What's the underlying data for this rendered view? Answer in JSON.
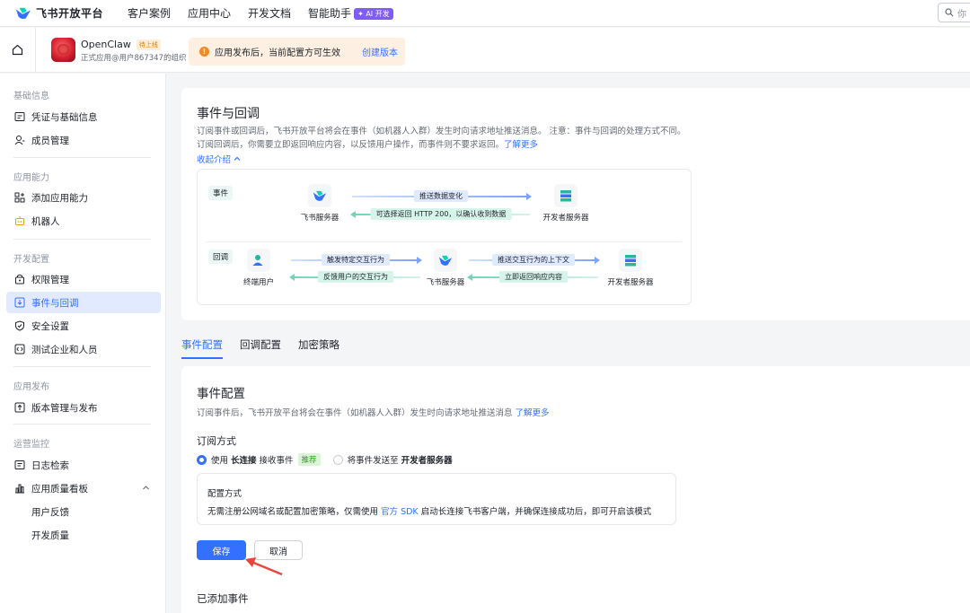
{
  "topnav": {
    "brand": "飞书开放平台",
    "links": [
      "客户案例",
      "应用中心",
      "开发文档",
      "智能助手"
    ],
    "ai_badge": "AI 开发",
    "search_placeholder": "你"
  },
  "app": {
    "name": "OpenClaw",
    "status": "待上线",
    "owner": "正式应用@用户867347的组织",
    "notice": "应用发布后，当前配置方可生效",
    "notice_link": "创建版本"
  },
  "sidebar": {
    "groups": [
      {
        "label": "基础信息",
        "items": [
          {
            "label": "凭证与基础信息",
            "icon": "credential-icon"
          },
          {
            "label": "成员管理",
            "icon": "member-icon"
          }
        ]
      },
      {
        "label": "应用能力",
        "items": [
          {
            "label": "添加应用能力",
            "icon": "add-capability-icon"
          },
          {
            "label": "机器人",
            "icon": "robot-icon"
          }
        ]
      },
      {
        "label": "开发配置",
        "items": [
          {
            "label": "权限管理",
            "icon": "permission-icon"
          },
          {
            "label": "事件与回调",
            "icon": "event-icon"
          },
          {
            "label": "安全设置",
            "icon": "shield-icon"
          },
          {
            "label": "测试企业和人员",
            "icon": "test-icon"
          }
        ]
      },
      {
        "label": "应用发布",
        "items": [
          {
            "label": "版本管理与发布",
            "icon": "publish-icon"
          }
        ]
      },
      {
        "label": "运营监控",
        "items": [
          {
            "label": "日志检索",
            "icon": "log-icon"
          },
          {
            "label": "应用质量看板",
            "icon": "chart-icon"
          },
          {
            "label": "用户反馈"
          },
          {
            "label": "开发质量"
          }
        ]
      }
    ]
  },
  "intro": {
    "title": "事件与回调",
    "desc": "订阅事件或回调后，飞书开放平台将会在事件（如机器人入群）发生时向请求地址推送消息。 注意：事件与回调的处理方式不同。订阅回调后，你需要立即返回响应内容，以反馈用户操作，而事件则不要求返回。",
    "learn_more": "了解更多",
    "collapse": "收起介绍",
    "diagram": {
      "tag_event": "事件",
      "tag_callback": "回调",
      "feishu_server": "飞书服务器",
      "dev_server": "开发者服务器",
      "end_user": "终端用户",
      "push_data": "推送数据变化",
      "return_200": "可选择返回 HTTP 200，以确认收到数据",
      "trigger": "触发特定交互行为",
      "feedback": "反馈用户的交互行为",
      "push_ctx": "推送交互行为的上下文",
      "return_resp": "立即返回响应内容"
    }
  },
  "tabs": [
    "事件配置",
    "回调配置",
    "加密策略"
  ],
  "event_config": {
    "title": "事件配置",
    "desc": "订阅事件后，飞书开放平台将会在事件（如机器人入群）发生时向请求地址推送消息",
    "learn_more": "了解更多",
    "sub_label": "订阅方式",
    "opt1_pre": "使用",
    "opt1_bold": "长连接",
    "opt1_post": "接收事件",
    "opt1_tag": "推荐",
    "opt2_pre": "将事件发送至",
    "opt2_bold": "开发者服务器",
    "box_title": "配置方式",
    "box_desc_pre": "无需注册公网域名或配置加密策略，仅需使用",
    "box_desc_link": "官方 SDK",
    "box_desc_post": "启动长连接飞书客户端，并确保连接成功后，即可开启该模式",
    "save": "保存",
    "cancel": "取消",
    "added_title": "已添加事件"
  }
}
